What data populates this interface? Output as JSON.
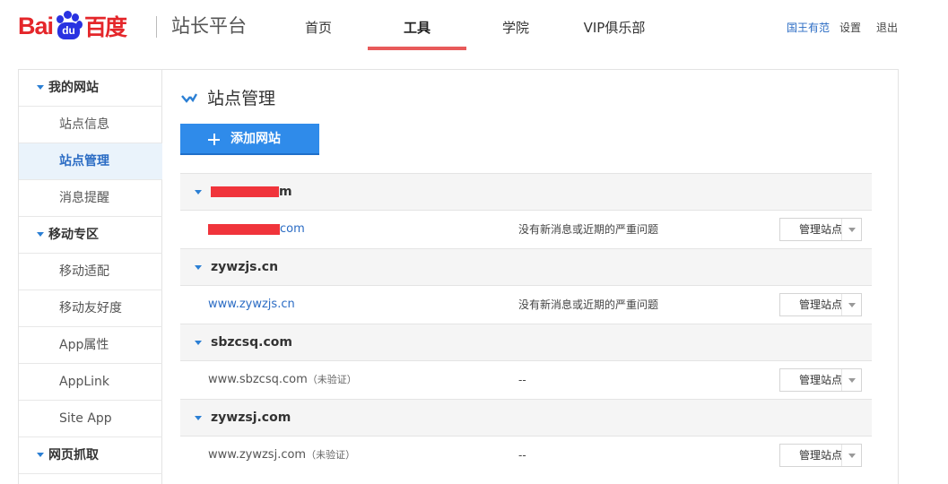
{
  "header": {
    "logo": {
      "part_latin": "Bai",
      "part_paw": "du",
      "part_chinese": "百度"
    },
    "site_title": "站长平台",
    "nav": [
      {
        "label": "首页",
        "active": false
      },
      {
        "label": "工具",
        "active": true
      },
      {
        "label": "学院",
        "active": false
      },
      {
        "label": "VIP俱乐部",
        "active": false
      }
    ],
    "user_name": "国王有范",
    "settings_label": "设置",
    "logout_label": "退出"
  },
  "sidebar": {
    "groups": [
      {
        "label": "我的网站",
        "items": [
          "站点信息",
          "站点管理",
          "消息提醒"
        ]
      },
      {
        "label": "移动专区",
        "items": [
          "移动适配",
          "移动友好度",
          "App属性",
          "AppLink",
          "Site App"
        ]
      },
      {
        "label": "网页抓取",
        "items": []
      }
    ],
    "active_item": "站点管理"
  },
  "content": {
    "title": "站点管理",
    "add_button_label": "添加网站",
    "manage_label": "管理站点",
    "sites": [
      {
        "group": "m",
        "url": "com",
        "url_suffix": "",
        "status": "没有新消息或近期的严重问题",
        "verified": true,
        "redacted": true
      },
      {
        "group": "zywzjs.cn",
        "url": "www.zywzjs.cn",
        "url_suffix": "",
        "status": "没有新消息或近期的严重问题",
        "verified": true,
        "redacted": false
      },
      {
        "group": "sbzcsq.com",
        "url": "www.sbzcsq.com",
        "url_suffix": "（未验证）",
        "status": "--",
        "verified": false,
        "redacted": false
      },
      {
        "group": "zywzsj.com",
        "url": "www.zywzsj.com",
        "url_suffix": "（未验证）",
        "status": "--",
        "verified": false,
        "redacted": false
      }
    ]
  },
  "colors": {
    "brand_red": "#e4262a",
    "brand_blue": "#2932e1",
    "accent_blue": "#2f8bea",
    "nav_underline": "#e85a5a",
    "link_blue": "#2b6cc4"
  },
  "icons": [
    "caret-down-icon",
    "check-mark-icon",
    "plus-icon",
    "dropdown-caret-icon"
  ]
}
